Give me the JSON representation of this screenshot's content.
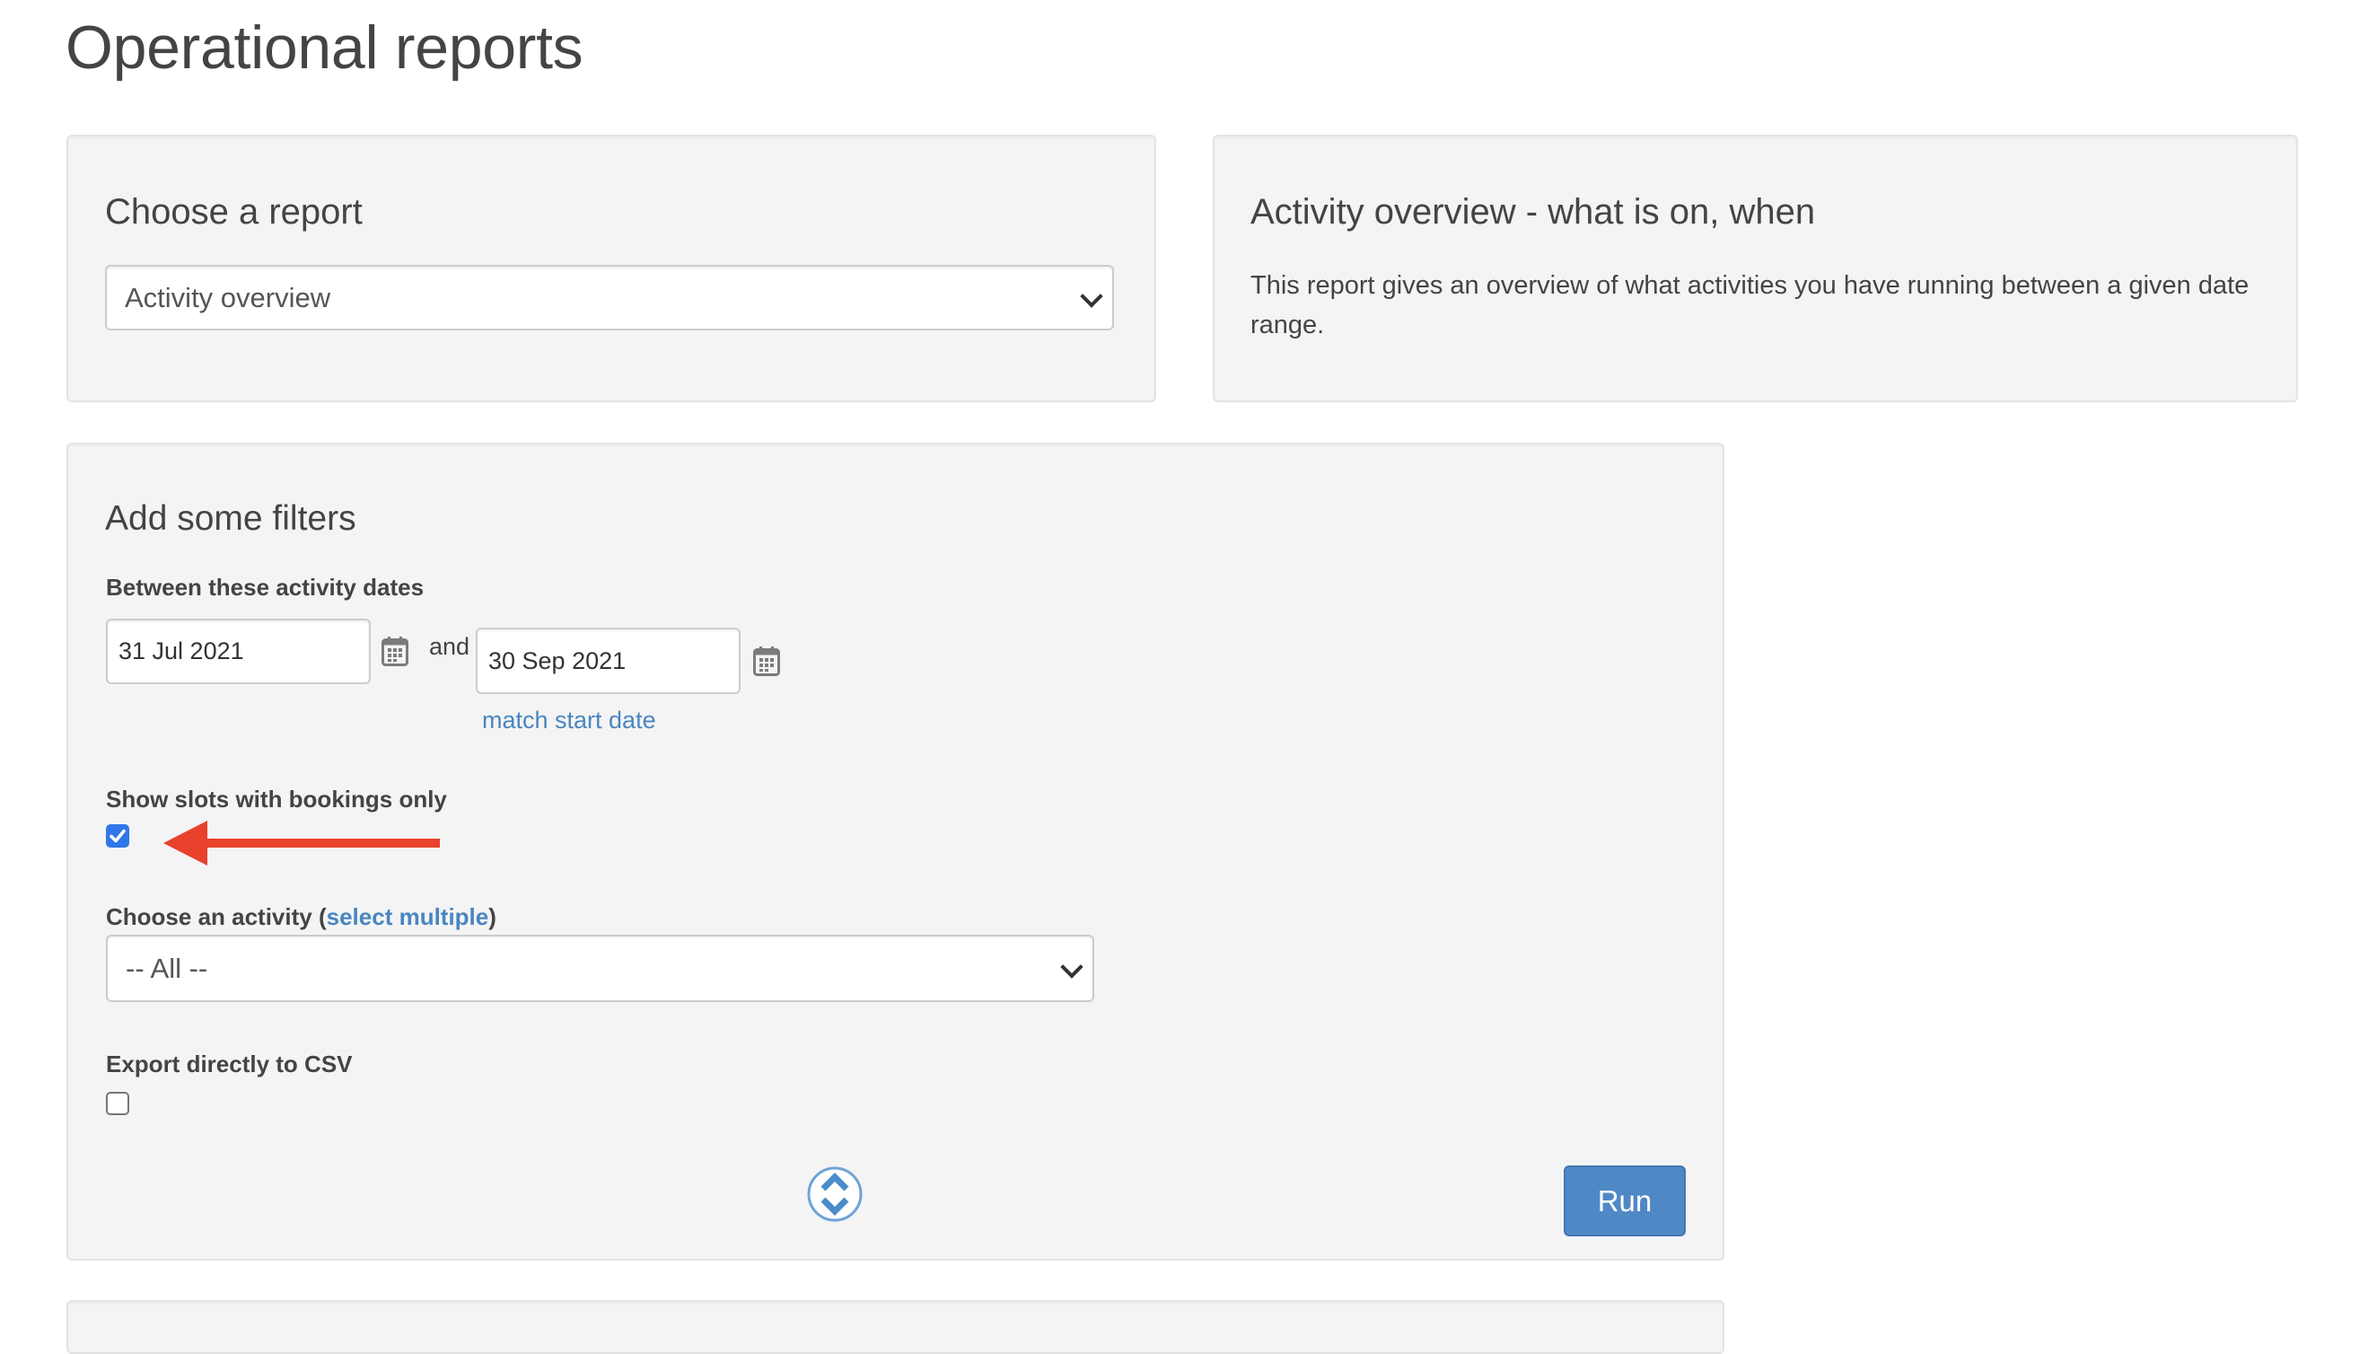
{
  "page": {
    "title": "Operational reports"
  },
  "report_chooser": {
    "heading": "Choose a report",
    "selected_report": "Activity overview"
  },
  "report_info": {
    "heading": "Activity overview - what is on, when",
    "description": "This report gives an overview of what activities you have running between a given date range."
  },
  "filters": {
    "heading": "Add some filters",
    "date_range": {
      "label": "Between these activity dates",
      "start_date": "31 Jul 2021",
      "connector": "and",
      "end_date": "30 Sep 2021",
      "match_start_link": "match start date"
    },
    "bookings_only": {
      "label": "Show slots with bookings only",
      "checked": true
    },
    "activity": {
      "label": "Choose an activity (",
      "select_multiple_link": "select multiple",
      "label_close": ")",
      "selected": "-- All --"
    },
    "export_csv": {
      "label": "Export directly to CSV",
      "checked": false
    },
    "run_label": "Run"
  },
  "annotation": {
    "arrow_color": "#e8412c",
    "points_to": "bookings-only-checkbox"
  },
  "colors": {
    "primary_button": "#5088c6",
    "link": "#4a86c0",
    "panel_bg": "#f4f4f4",
    "checkbox_checked": "#2f76e8"
  }
}
